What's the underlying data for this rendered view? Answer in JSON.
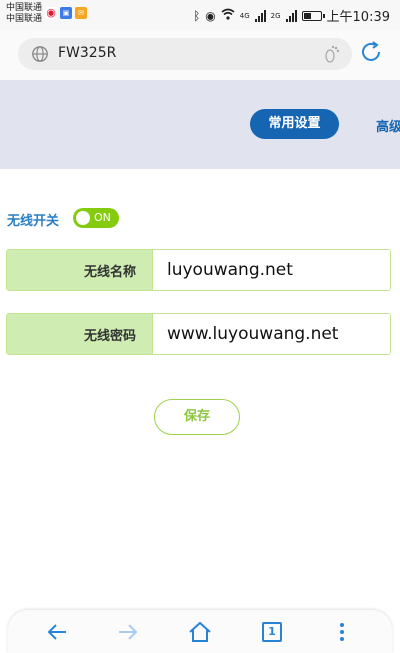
{
  "status_bar": {
    "carrier_1": "中国联通",
    "carrier_2": "中国联通",
    "network_1": "4G",
    "network_2": "2G",
    "battery_percent": 40,
    "time": "上午10:39",
    "app_icons": [
      "weibo-icon",
      "alipay-icon",
      "message-icon"
    ]
  },
  "browser": {
    "url": "FW325R",
    "icons": [
      "globe-icon",
      "footprint-icon",
      "reload-icon"
    ]
  },
  "header": {
    "tabs": [
      {
        "label": "常用设置",
        "active": true
      },
      {
        "label": "高级设置",
        "active": false
      }
    ]
  },
  "wireless": {
    "switch_label": "无线开关",
    "switch_state": "ON",
    "ssid_label": "无线名称",
    "ssid_value": "luyouwang.net",
    "password_label": "无线密码",
    "password_value": "www.luyouwang.net",
    "save_label": "保存"
  },
  "bottom_nav": {
    "icons": [
      "back-icon",
      "forward-icon",
      "home-icon",
      "tabs-icon",
      "menu-icon"
    ],
    "tab_count": "1"
  },
  "colors": {
    "accent_blue": "#1565b3",
    "toggle_green": "#85cc10",
    "label_green": "#cfedb3",
    "header_band": "#e1e3ef"
  }
}
